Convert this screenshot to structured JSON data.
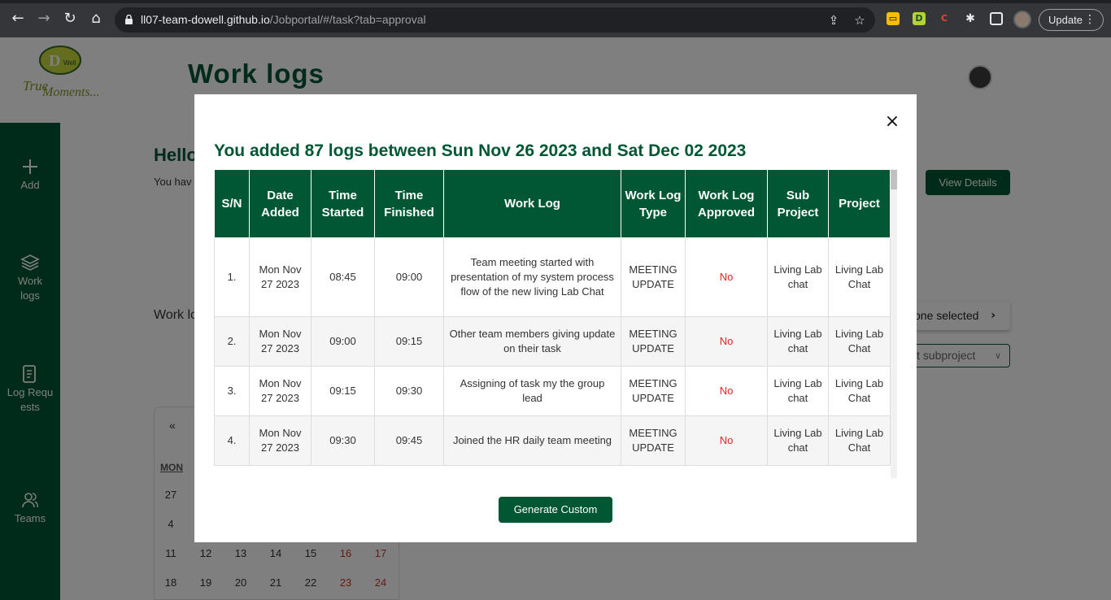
{
  "browser": {
    "url_host": "ll07-team-dowell.github.io",
    "url_path": "/Jobportal/#/task?tab=approval",
    "update_label": "Update"
  },
  "page": {
    "title": "Work logs",
    "logo_text": "True Moments...",
    "logo_badge": "D'Well",
    "hello": "Hello",
    "you_have": "You hav",
    "view_details": "View Details",
    "worklogs_label": "Work lo",
    "none_selected": "one selected",
    "select_subproject": "t subproject",
    "sidebar": [
      {
        "label": "Add",
        "icon": "plus-icon"
      },
      {
        "label": "Work logs",
        "icon": "layers-icon"
      },
      {
        "label": "Log Requests",
        "icon": "document-icon"
      },
      {
        "label": "Teams",
        "icon": "people-icon"
      }
    ],
    "calendar": {
      "prev": "«",
      "mon": "MON",
      "rows": [
        [
          "27"
        ],
        [
          "4"
        ],
        [
          "11",
          "12",
          "13",
          "14",
          "15",
          "16",
          "17"
        ],
        [
          "18",
          "19",
          "20",
          "21",
          "22",
          "23",
          "24"
        ]
      ]
    }
  },
  "modal": {
    "title": "You added 87 logs between Sun Nov 26 2023 and Sat Dec 02 2023",
    "close_label": "×",
    "columns": [
      "S/N",
      "Date Added",
      "Time Started",
      "Time Finished",
      "Work Log",
      "Work Log Type",
      "Work Log Approved",
      "Sub Project",
      "Project"
    ],
    "rows": [
      {
        "sn": "1.",
        "date": "Mon Nov 27 2023",
        "start": "08:45",
        "end": "09:00",
        "log": "Team meeting started with presentation of my system process flow of the new living Lab Chat",
        "type": "MEETING UPDATE",
        "approved": "No",
        "sub": "Living Lab chat",
        "project": "Living Lab Chat"
      },
      {
        "sn": "2.",
        "date": "Mon Nov 27 2023",
        "start": "09:00",
        "end": "09:15",
        "log": "Other team members giving update on their task",
        "type": "MEETING UPDATE",
        "approved": "No",
        "sub": "Living Lab chat",
        "project": "Living Lab Chat"
      },
      {
        "sn": "3.",
        "date": "Mon Nov 27 2023",
        "start": "09:15",
        "end": "09:30",
        "log": "Assigning of task my the group lead",
        "type": "MEETING UPDATE",
        "approved": "No",
        "sub": "Living Lab chat",
        "project": "Living Lab Chat"
      },
      {
        "sn": "4.",
        "date": "Mon Nov 27 2023",
        "start": "09:30",
        "end": "09:45",
        "log": "Joined the HR daily team meeting",
        "type": "MEETING UPDATE",
        "approved": "No",
        "sub": "Living Lab chat",
        "project": "Living Lab Chat"
      }
    ],
    "generate_label": "Generate Custom"
  },
  "colors": {
    "brand_green": "#005734",
    "no_red": "#e02424"
  }
}
